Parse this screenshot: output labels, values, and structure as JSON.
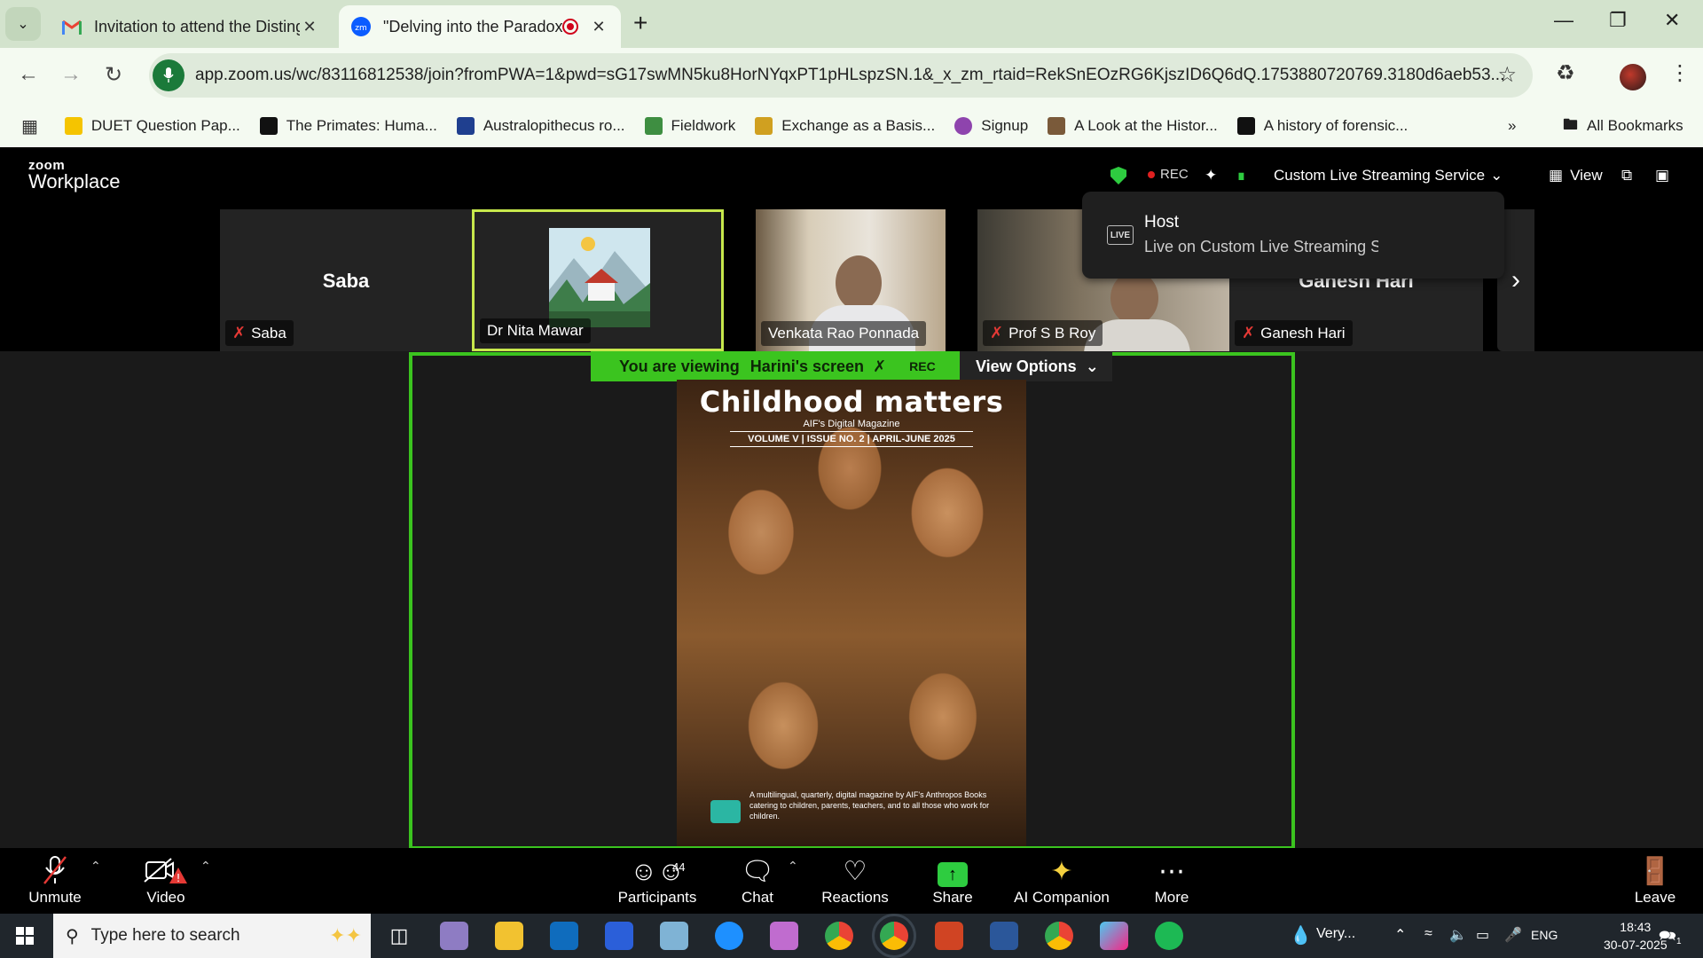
{
  "browser": {
    "tabs": [
      {
        "title": "Invitation to attend the Disting...",
        "favicon": "gmail-icon"
      },
      {
        "title": "\"Delving into the Paradoxic...",
        "favicon": "zoom-icon"
      }
    ],
    "url": "app.zoom.us/wc/83116812538/join?fromPWA=1&pwd=sG17swMN5ku8HorNYqxPT1pHLspzSN.1&_x_zm_rtaid=RekSnEOzRG6KjszID6Q6dQ.1753880720769.3180d6aeb53...",
    "bookmarks": [
      {
        "label": "DUET Question Pap...",
        "color": "#f5c400"
      },
      {
        "label": "The Primates: Huma...",
        "color": "#111111"
      },
      {
        "label": "Australopithecus ro...",
        "color": "#1f3f8f"
      },
      {
        "label": "Fieldwork",
        "color": "#3e8e41"
      },
      {
        "label": "Exchange as a Basis...",
        "color": "#d0a020"
      },
      {
        "label": "Signup",
        "color": "#8e44ad"
      },
      {
        "label": "A Look at the Histor...",
        "color": "#7a5a3a"
      },
      {
        "label": "A history of forensic...",
        "color": "#111111"
      }
    ],
    "all_bookmarks": "All Bookmarks"
  },
  "zoom": {
    "logo_small": "zoom",
    "logo_big": "Workplace",
    "rec": "REC",
    "streaming": "Custom Live Streaming Service",
    "view": "View",
    "host_popup": {
      "badge": "LIVE",
      "title": "Host",
      "subtitle": "Live on Custom Live Streaming Service"
    },
    "participants": [
      {
        "name": "Saba",
        "big_name": "Saba",
        "muted": true
      },
      {
        "name": "Dr Nita Mawar",
        "muted": false
      },
      {
        "name": "Venkata Rao Ponnada",
        "muted": false
      },
      {
        "name": "Prof S B Roy",
        "muted": true
      },
      {
        "name": "Ganesh Hari",
        "big_name": "Ganesh Hari",
        "muted": true
      }
    ],
    "viewing": {
      "prefix": "You are viewing",
      "owner": "Harini's screen",
      "rec": "REC"
    },
    "view_options": "View Options",
    "magazine": {
      "title": "Childhood matters",
      "subtitle": "AIF's Digital Magazine",
      "volume": "VOLUME V | ISSUE NO. 2 | APRIL-JUNE 2025",
      "footer": "A multilingual, quarterly, digital magazine by AIF's Anthropos Books catering to children, parents, teachers, and to all those who work for children."
    },
    "controls": {
      "unmute": "Unmute",
      "video": "Video",
      "participants": "Participants",
      "participant_count": "44",
      "chat": "Chat",
      "reactions": "Reactions",
      "share": "Share",
      "ai_companion": "AI Companion",
      "more": "More",
      "leave": "Leave"
    }
  },
  "taskbar": {
    "search_placeholder": "Type here to search",
    "weather": "Very...",
    "lang": "ENG",
    "time": "18:43",
    "date": "30-07-2025",
    "notifications": "1"
  }
}
